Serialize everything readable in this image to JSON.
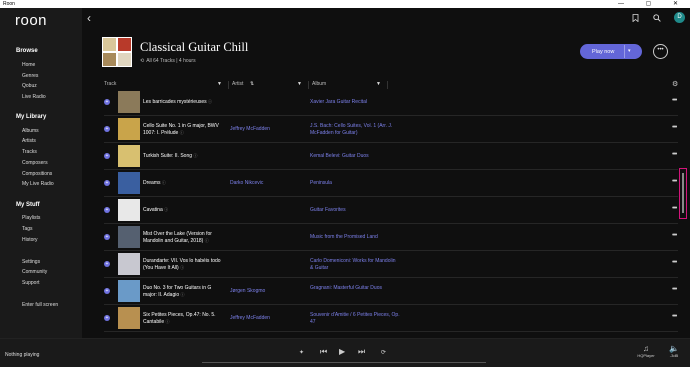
{
  "app": {
    "title": "Roon",
    "logo": "roon"
  },
  "window": {
    "controls": "— ▢ ✕"
  },
  "sidebar": {
    "browse": {
      "label": "Browse",
      "items": [
        "Home",
        "Genres",
        "Qobuz",
        "Live Radio"
      ]
    },
    "library": {
      "label": "My Library",
      "items": [
        "Albums",
        "Artists",
        "Tracks",
        "Composers",
        "Compositions",
        "My Live Radio"
      ]
    },
    "stuff": {
      "label": "My Stuff",
      "items": [
        "Playlists",
        "Tags",
        "History"
      ]
    },
    "other": {
      "items": [
        "Settings",
        "Community",
        "Support"
      ]
    },
    "fullscreen": "Enter full screen"
  },
  "header": {
    "back_icon": "‹",
    "bookmark_icon": "bookmark-icon",
    "search_icon": "search-icon",
    "avatar_letter": "D",
    "playlist_title": "Classical Guitar Chill",
    "meta": "All 64 Tracks | 4 hours",
    "play_label": "Play now",
    "play_dropdown": "▾",
    "more_label": "•••"
  },
  "columns": {
    "track": "Track",
    "artist": "Artist",
    "album": "Album"
  },
  "tracks": [
    {
      "title": "Les barricades mystérieuses",
      "artist": "",
      "album": "Xavier Jara Guitar Recital",
      "thumb": "#8b7a5a"
    },
    {
      "title": "Cello Suite No. 1 in G major, BWV 1007: I. Prélude",
      "artist": "Jeffrey McFadden",
      "album": "J.S. Bach: Cello Suites, Vol. 1 (Arr. J. McFadden for Guitar)",
      "thumb": "#c9a44a"
    },
    {
      "title": "Turkish Suite: II. Song",
      "artist": "",
      "album": "Kemal Belevi: Guitar Duos",
      "thumb": "#d8c070"
    },
    {
      "title": "Dreams",
      "artist": "Darko Nikcevic",
      "album": "Peninsula",
      "thumb": "#3a5fa0"
    },
    {
      "title": "Cavatina",
      "artist": "",
      "album": "Guitar Favorites",
      "thumb": "#e8e8e8"
    },
    {
      "title": "Mist Over the Lake (Version for Mandolin and Guitar, 2018)",
      "artist": "",
      "album": "Music from the Promised Land",
      "thumb": "#556070"
    },
    {
      "title": "Durandarte: VII. Vos lo habéis todo (You Have It All)",
      "artist": "",
      "album": "Carlo Domeniconi: Works for Mandolin & Guitar",
      "thumb": "#c8c8d0"
    },
    {
      "title": "Duo No. 3 for Two Guitars in G major: II. Adagio",
      "artist": "Jørgen Skogmo",
      "album": "Gragnani: Masterful Guitar Duos",
      "thumb": "#6a9ac8"
    },
    {
      "title": "Six Petites Pieces, Op.47: No. 5. Cantabile",
      "artist": "Jeffrey McFadden",
      "album": "Souvenir d'Amitie / 6 Petites Pieces, Op. 47",
      "thumb": "#b89050"
    }
  ],
  "footer": {
    "now_playing": "Nothing playing",
    "zone": "HQPlayer",
    "volume": "-3dB"
  }
}
